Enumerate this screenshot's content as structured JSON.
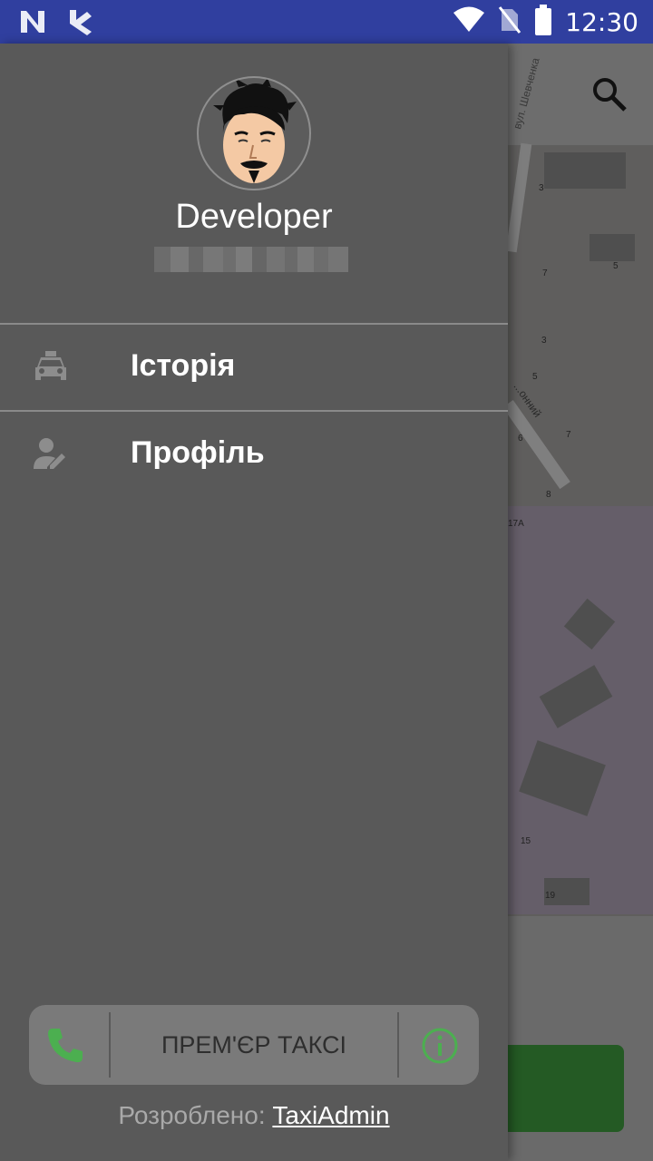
{
  "status_bar": {
    "time": "12:30",
    "icons": [
      "n-notification-icon",
      "app-notification-icon",
      "wifi-icon",
      "no-sim-icon",
      "battery-icon"
    ]
  },
  "map": {
    "street_top": "вул. Шевченка",
    "street_diag": "...онний",
    "house_numbers": [
      "3",
      "7",
      "5",
      "3",
      "5",
      "6",
      "7",
      "8",
      "17A",
      "15",
      "19"
    ]
  },
  "drawer": {
    "user_name": "Developer",
    "menu": [
      {
        "label": "Історія",
        "icon": "taxi-car-icon"
      },
      {
        "label": "Профіль",
        "icon": "edit-profile-icon"
      }
    ],
    "company_name": "ПРЕМ'ЄР ТАКСІ",
    "credit_prefix": "Розроблено: ",
    "credit_link": "TaxiAdmin"
  },
  "colors": {
    "status_bar": "#303f9f",
    "drawer_bg": "#595959",
    "accent_green": "#4caf50"
  }
}
